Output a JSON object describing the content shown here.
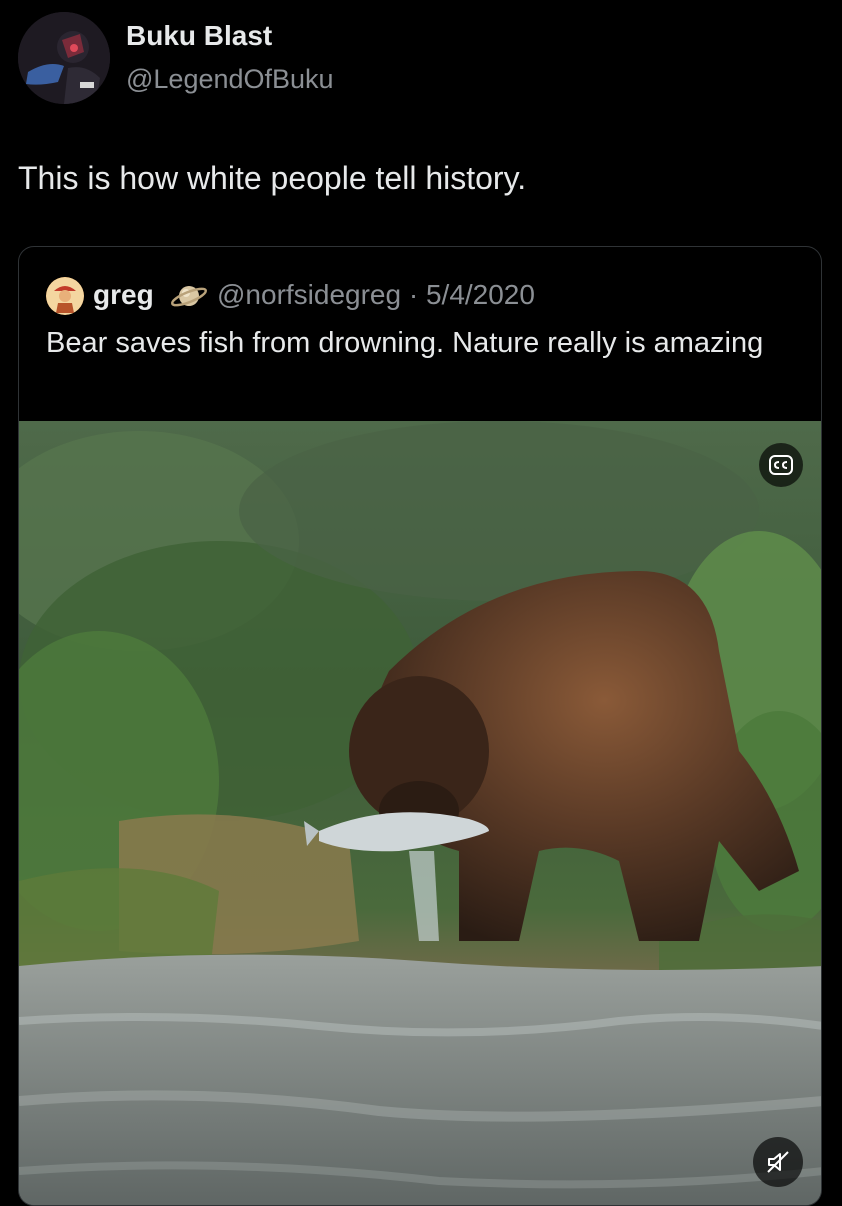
{
  "tweet": {
    "author_name": "Buku Blast",
    "author_handle": "@LegendOfBuku",
    "text": "This is how white people tell history."
  },
  "quoted_tweet": {
    "author_name": "greg",
    "author_handle_date": "@norfsidegreg · 5/4/2020",
    "text": "Bear saves fish from drowning. Nature really is amazing",
    "badge_icon": "saturn-planet-emoji",
    "media": {
      "type": "video",
      "description_icons": [
        "closed-captions-icon",
        "muted-speaker-icon"
      ]
    }
  }
}
